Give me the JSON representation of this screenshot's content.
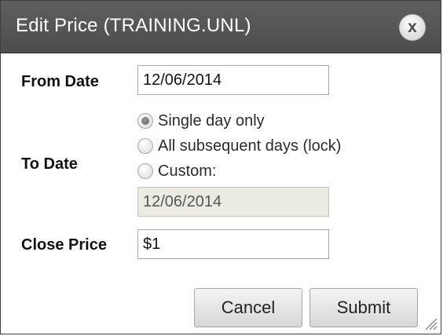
{
  "dialog": {
    "title": "Edit Price (TRAINING.UNL)",
    "close_label": "x"
  },
  "form": {
    "from_date_label": "From Date",
    "from_date_value": "12/06/2014",
    "to_date_label": "To Date",
    "to_date_options": [
      {
        "label": "Single day only",
        "checked": true
      },
      {
        "label": "All subsequent days (lock)",
        "checked": false
      },
      {
        "label": "Custom:",
        "checked": false
      }
    ],
    "custom_date_value": "12/06/2014",
    "close_price_label": "Close Price",
    "close_price_value": "$1"
  },
  "buttons": {
    "cancel_label": "Cancel",
    "submit_label": "Submit"
  },
  "icons": {
    "close": "close-icon",
    "radio_checked": "radio-checked-icon",
    "radio_unchecked": "radio-unchecked-icon",
    "resize": "resize-grip-icon"
  }
}
